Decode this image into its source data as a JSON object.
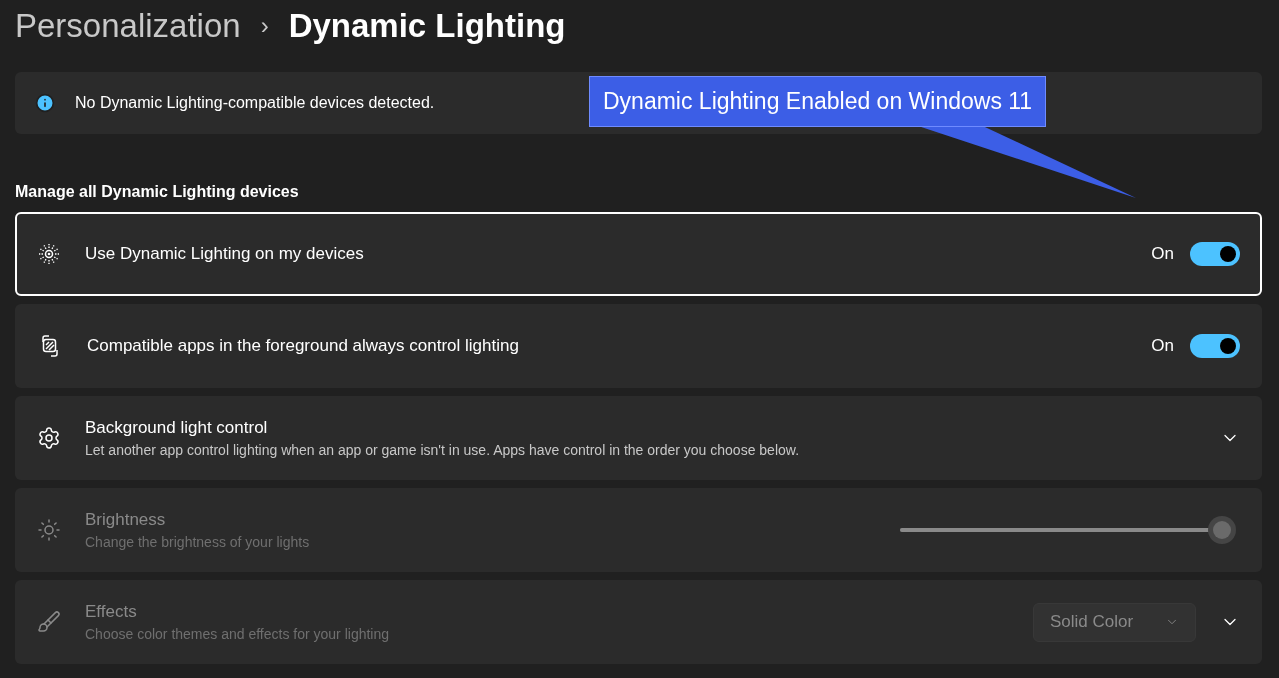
{
  "breadcrumb": {
    "parent": "Personalization",
    "separator": "›",
    "current": "Dynamic Lighting"
  },
  "info": {
    "text": "No Dynamic Lighting-compatible devices detected."
  },
  "callout": {
    "text": "Dynamic Lighting Enabled on Windows 11"
  },
  "section_heading": "Manage all Dynamic Lighting devices",
  "rows": [
    {
      "kind": "toggle",
      "title": "Use Dynamic Lighting on my devices",
      "state_label": "On",
      "on": true,
      "focused": true,
      "disabled": false
    },
    {
      "kind": "toggle",
      "title": "Compatible apps in the foreground always control lighting",
      "state_label": "On",
      "on": true,
      "focused": false,
      "disabled": false
    },
    {
      "kind": "expander",
      "title": "Background light control",
      "description": "Let another app control lighting when an app or game isn't in use. Apps have control in the order you choose below.",
      "focused": false,
      "disabled": false
    },
    {
      "kind": "slider",
      "title": "Brightness",
      "description": "Change the brightness of your lights",
      "level": 1,
      "focused": false,
      "disabled": true
    },
    {
      "kind": "dropdown",
      "title": "Effects",
      "description": "Choose color themes and effects for your lighting",
      "value": "Solid Color",
      "focused": false,
      "disabled": true
    }
  ]
}
